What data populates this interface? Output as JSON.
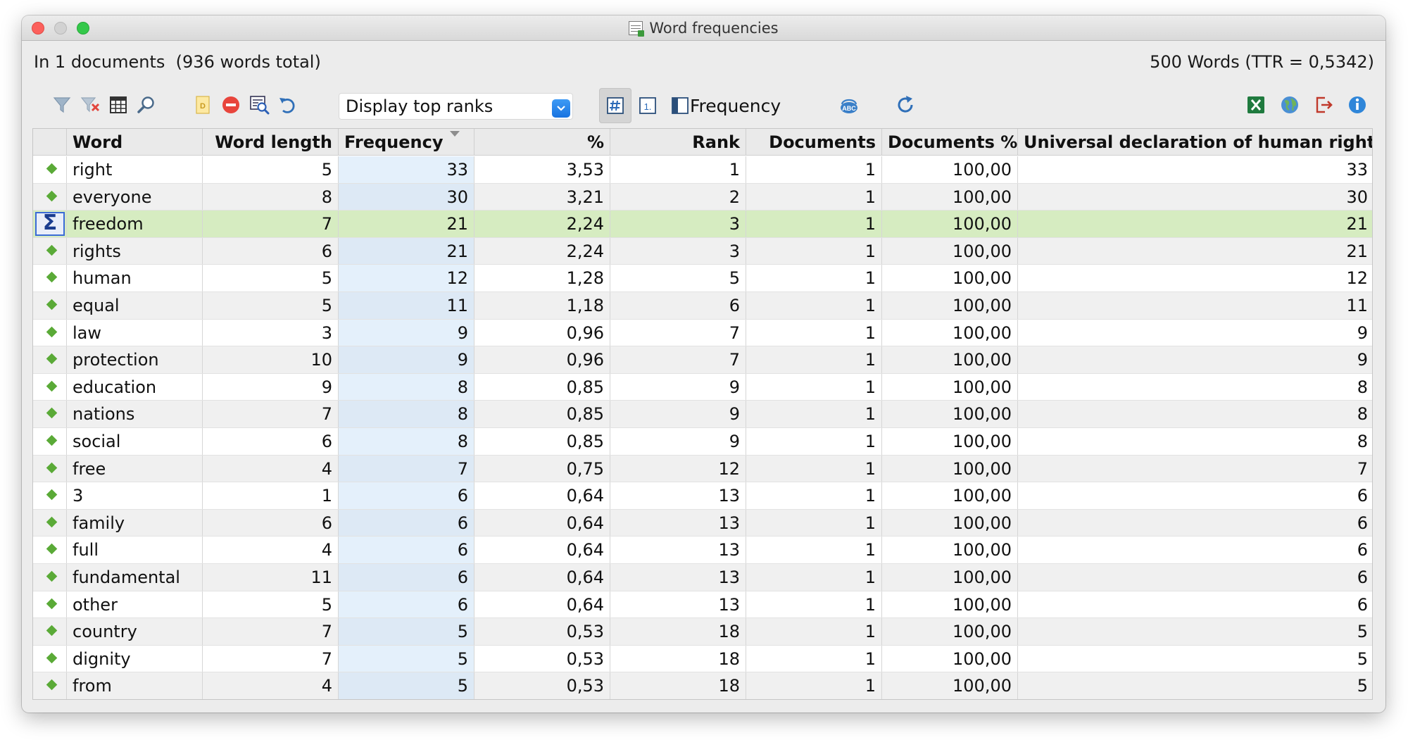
{
  "window": {
    "title": "Word frequencies"
  },
  "info": {
    "documents_text": "In 1 documents  (936 words total)",
    "words_text": "500 Words (TTR = 0,5342)"
  },
  "toolbar": {
    "display_select": "Display top ranks",
    "frequency_label": "Frequency",
    "icons": [
      "filter-icon",
      "clear-filter-icon",
      "columns-icon",
      "search-icon",
      "document-icon",
      "delete-icon",
      "search-results-icon",
      "undo-icon",
      "display-select",
      "hash-view-icon",
      "rank-view-icon",
      "doc-view-icon",
      "spell-check-icon",
      "refresh-icon",
      "excel-export-icon",
      "web-export-icon",
      "export-icon",
      "info-icon"
    ]
  },
  "table": {
    "columns": [
      "Word",
      "Word length",
      "Frequency",
      "%",
      "Rank",
      "Documents",
      "Documents %",
      "Universal declaration of human rights"
    ],
    "sorted_column": "Frequency",
    "selected_row": 2,
    "rows": [
      {
        "word": "right",
        "len": "5",
        "freq": "33",
        "pct": "3,53",
        "rank": "1",
        "docs": "1",
        "docs_pct": "100,00",
        "udhr": "33"
      },
      {
        "word": "everyone",
        "len": "8",
        "freq": "30",
        "pct": "3,21",
        "rank": "2",
        "docs": "1",
        "docs_pct": "100,00",
        "udhr": "30"
      },
      {
        "word": "freedom",
        "len": "7",
        "freq": "21",
        "pct": "2,24",
        "rank": "3",
        "docs": "1",
        "docs_pct": "100,00",
        "udhr": "21"
      },
      {
        "word": "rights",
        "len": "6",
        "freq": "21",
        "pct": "2,24",
        "rank": "3",
        "docs": "1",
        "docs_pct": "100,00",
        "udhr": "21"
      },
      {
        "word": "human",
        "len": "5",
        "freq": "12",
        "pct": "1,28",
        "rank": "5",
        "docs": "1",
        "docs_pct": "100,00",
        "udhr": "12"
      },
      {
        "word": "equal",
        "len": "5",
        "freq": "11",
        "pct": "1,18",
        "rank": "6",
        "docs": "1",
        "docs_pct": "100,00",
        "udhr": "11"
      },
      {
        "word": "law",
        "len": "3",
        "freq": "9",
        "pct": "0,96",
        "rank": "7",
        "docs": "1",
        "docs_pct": "100,00",
        "udhr": "9"
      },
      {
        "word": "protection",
        "len": "10",
        "freq": "9",
        "pct": "0,96",
        "rank": "7",
        "docs": "1",
        "docs_pct": "100,00",
        "udhr": "9"
      },
      {
        "word": "education",
        "len": "9",
        "freq": "8",
        "pct": "0,85",
        "rank": "9",
        "docs": "1",
        "docs_pct": "100,00",
        "udhr": "8"
      },
      {
        "word": "nations",
        "len": "7",
        "freq": "8",
        "pct": "0,85",
        "rank": "9",
        "docs": "1",
        "docs_pct": "100,00",
        "udhr": "8"
      },
      {
        "word": "social",
        "len": "6",
        "freq": "8",
        "pct": "0,85",
        "rank": "9",
        "docs": "1",
        "docs_pct": "100,00",
        "udhr": "8"
      },
      {
        "word": "free",
        "len": "4",
        "freq": "7",
        "pct": "0,75",
        "rank": "12",
        "docs": "1",
        "docs_pct": "100,00",
        "udhr": "7"
      },
      {
        "word": "3",
        "len": "1",
        "freq": "6",
        "pct": "0,64",
        "rank": "13",
        "docs": "1",
        "docs_pct": "100,00",
        "udhr": "6"
      },
      {
        "word": "family",
        "len": "6",
        "freq": "6",
        "pct": "0,64",
        "rank": "13",
        "docs": "1",
        "docs_pct": "100,00",
        "udhr": "6"
      },
      {
        "word": "full",
        "len": "4",
        "freq": "6",
        "pct": "0,64",
        "rank": "13",
        "docs": "1",
        "docs_pct": "100,00",
        "udhr": "6"
      },
      {
        "word": "fundamental",
        "len": "11",
        "freq": "6",
        "pct": "0,64",
        "rank": "13",
        "docs": "1",
        "docs_pct": "100,00",
        "udhr": "6"
      },
      {
        "word": "other",
        "len": "5",
        "freq": "6",
        "pct": "0,64",
        "rank": "13",
        "docs": "1",
        "docs_pct": "100,00",
        "udhr": "6"
      },
      {
        "word": "country",
        "len": "7",
        "freq": "5",
        "pct": "0,53",
        "rank": "18",
        "docs": "1",
        "docs_pct": "100,00",
        "udhr": "5"
      },
      {
        "word": "dignity",
        "len": "7",
        "freq": "5",
        "pct": "0,53",
        "rank": "18",
        "docs": "1",
        "docs_pct": "100,00",
        "udhr": "5"
      },
      {
        "word": "from",
        "len": "4",
        "freq": "5",
        "pct": "0,53",
        "rank": "18",
        "docs": "1",
        "docs_pct": "100,00",
        "udhr": "5"
      }
    ]
  }
}
